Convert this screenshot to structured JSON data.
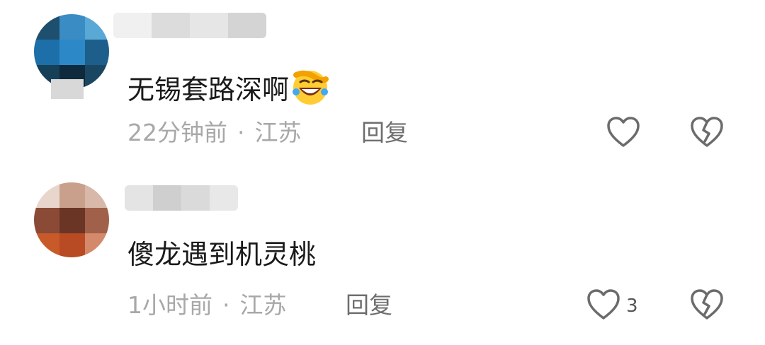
{
  "comments": [
    {
      "text": "无锡套路深啊",
      "emoji": "rofl-laughing-emoji",
      "time": "22分钟前",
      "separator": "·",
      "location": "江苏",
      "reply_label": "回复",
      "like_count": ""
    },
    {
      "text": "傻龙遇到机灵桃",
      "emoji": "",
      "time": "1小时前",
      "separator": "·",
      "location": "江苏",
      "reply_label": "回复",
      "like_count": "3"
    }
  ],
  "colors": {
    "text": "#1a1a1a",
    "meta": "#a8a8a8",
    "reply": "#6e6e6e",
    "icon": "#6b6b6b"
  }
}
